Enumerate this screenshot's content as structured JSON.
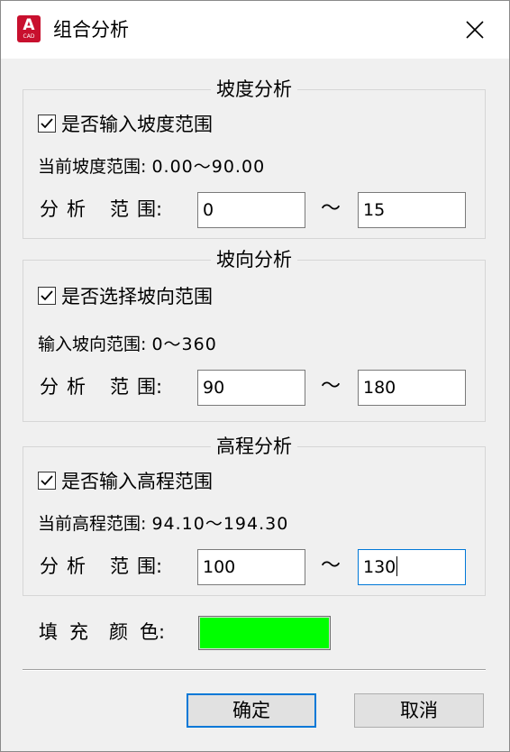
{
  "window": {
    "title": "组合分析",
    "icon_letter": "A",
    "icon_sub": "CAD"
  },
  "slope": {
    "group_title": "坡度分析",
    "checkbox_label": "是否输入坡度范围",
    "checked": true,
    "info_label": "当前坡度范围:",
    "info_value": "0.00～90.00",
    "range_label": [
      "分",
      "析",
      "范",
      "围:"
    ],
    "min": "0",
    "separator": "～",
    "max": "15"
  },
  "aspect": {
    "group_title": "坡向分析",
    "checkbox_label": "是否选择坡向范围",
    "checked": true,
    "info_label": "输入坡向范围:",
    "info_value": "0～360",
    "range_label": [
      "分",
      "析",
      "范",
      "围:"
    ],
    "min": "90",
    "separator": "～",
    "max": "180"
  },
  "elevation": {
    "group_title": "高程分析",
    "checkbox_label": "是否输入高程范围",
    "checked": true,
    "info_label": "当前高程范围:",
    "info_value": "94.10～194.30",
    "range_label": [
      "分",
      "析",
      "范",
      "围:"
    ],
    "min": "100",
    "separator": "～",
    "max": "130"
  },
  "fill": {
    "label": [
      "填",
      "充",
      "颜",
      "色:"
    ],
    "color": "#00ff00"
  },
  "buttons": {
    "ok": "确定",
    "cancel": "取消"
  },
  "colors": {
    "dialog_bg": "#f0f0f0",
    "focus_border": "#0078d7",
    "icon_red": "#c8102e"
  }
}
